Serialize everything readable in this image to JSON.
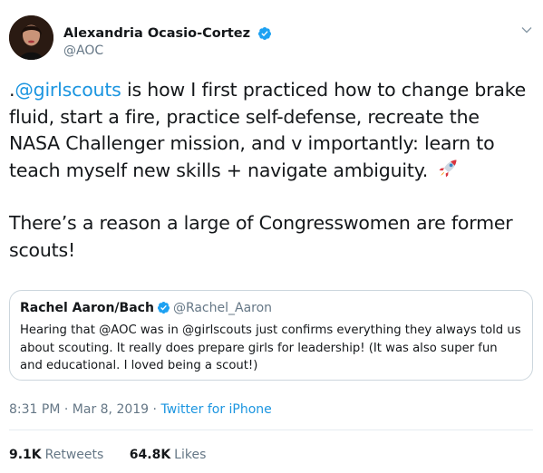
{
  "author": {
    "display_name": "Alexandria Ocasio-Cortez",
    "handle": "@AOC",
    "verified": true
  },
  "tweet": {
    "para1": [
      {
        "type": "text",
        "text": "."
      },
      {
        "type": "mention",
        "text": "@girlscouts"
      },
      {
        "type": "text",
        "text": " is how I first practiced how to change brake fluid, start a fire, practice self-defense, recreate the NASA Challenger mission, and v importantly: learn to teach myself new skills + navigate ambiguity. "
      }
    ],
    "emoji": "rocket-icon",
    "para2": "There’s a reason a large of Congresswomen are former scouts!"
  },
  "quoted_tweet": {
    "display_name": "Rachel Aaron/Bach",
    "handle": "@Rachel_Aaron",
    "text": "Hearing that @AOC was in @girlscouts just confirms everything they always told us about scouting. It really does prepare girls for leadership! (It was also super fun and educational. I loved being a scout!)"
  },
  "meta": {
    "time": "8:31 PM",
    "separator1": " · ",
    "date": "Mar 8, 2019",
    "separator2": " · ",
    "source": "Twitter for iPhone"
  },
  "stats": {
    "retweets_count": "9.1K",
    "retweets_label": "Retweets",
    "likes_count": "64.8K",
    "likes_label": "Likes"
  },
  "colors": {
    "link": "#1b95e0",
    "secondary_text": "#657786",
    "border": "#ccd6dd",
    "verified": "#1da1f2"
  }
}
